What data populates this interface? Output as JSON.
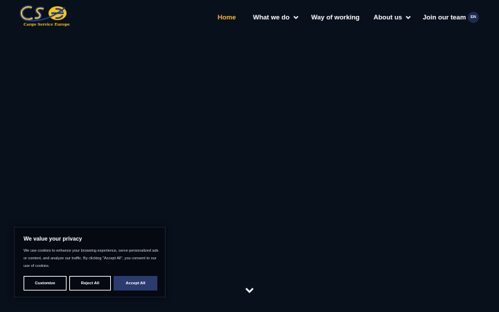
{
  "header": {
    "logo_text": "Cargo Service Europe",
    "nav": [
      {
        "label": "Home",
        "active": true,
        "has_dropdown": false
      },
      {
        "label": "What we do",
        "active": false,
        "has_dropdown": true
      },
      {
        "label": "Way of working",
        "active": false,
        "has_dropdown": false
      },
      {
        "label": "About us",
        "active": false,
        "has_dropdown": true
      },
      {
        "label": "Join our team",
        "active": false,
        "has_dropdown": false
      }
    ],
    "language": "EN"
  },
  "cookie_banner": {
    "title": "We value your privacy",
    "text": "We use cookies to enhance your browsing experience, serve personalized ads or content, and analyze our traffic. By clicking \"Accept All\", you consent to our use of cookies.",
    "buttons": {
      "customize": "Customize",
      "reject": "Reject All",
      "accept": "Accept All"
    }
  },
  "colors": {
    "background": "#08101c",
    "accent": "#f5b731",
    "logo_blue": "#1f3a8a",
    "button_primary": "#2a3c6e"
  },
  "icons": [
    "chevron-down-icon",
    "scroll-down-icon"
  ]
}
